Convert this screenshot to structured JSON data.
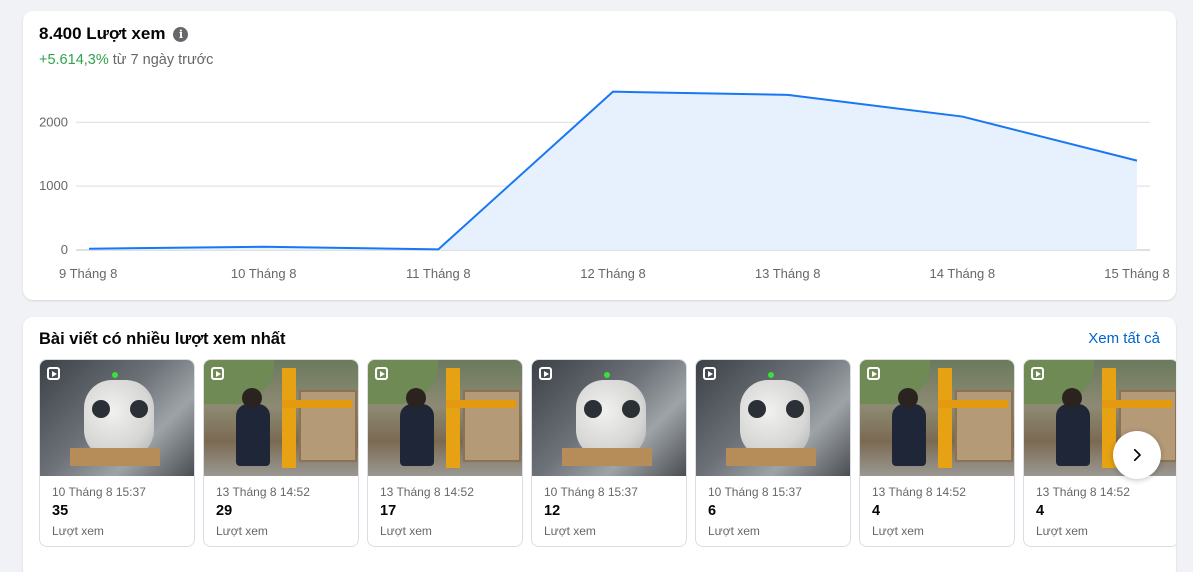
{
  "views_card": {
    "title": "8.400 Lượt xem",
    "change_pct": "+5.614,3%",
    "change_text": " từ 7 ngày trước",
    "info_icon": "info-icon"
  },
  "chart_data": {
    "type": "area",
    "x": [
      "9 Tháng 8",
      "10 Tháng 8",
      "11 Tháng 8",
      "12 Tháng 8",
      "13 Tháng 8",
      "14 Tháng 8",
      "15 Tháng 8"
    ],
    "y": [
      20,
      50,
      10,
      2480,
      2430,
      2090,
      1400
    ],
    "yticks": [
      0,
      1000,
      2000
    ],
    "ylim": [
      0,
      2600
    ],
    "grid": true,
    "line_color": "#1877f2",
    "fill_color": "#e7f0fd"
  },
  "posts_card": {
    "title": "Bài viết có nhiều lượt xem nhất",
    "see_all": "Xem tất cả",
    "next_icon": "chevron-right-icon",
    "posts": [
      {
        "date": "10 Tháng 8 15:37",
        "count": "35",
        "label": "Lượt xem",
        "thumb": "pump"
      },
      {
        "date": "13 Tháng 8 14:52",
        "count": "29",
        "label": "Lượt xem",
        "thumb": "worker"
      },
      {
        "date": "13 Tháng 8 14:52",
        "count": "17",
        "label": "Lượt xem",
        "thumb": "worker"
      },
      {
        "date": "10 Tháng 8 15:37",
        "count": "12",
        "label": "Lượt xem",
        "thumb": "pump"
      },
      {
        "date": "10 Tháng 8 15:37",
        "count": "6",
        "label": "Lượt xem",
        "thumb": "pump"
      },
      {
        "date": "13 Tháng 8 14:52",
        "count": "4",
        "label": "Lượt xem",
        "thumb": "worker"
      },
      {
        "date": "13 Tháng 8 14:52",
        "count": "4",
        "label": "Lượt xem",
        "thumb": "worker"
      }
    ]
  },
  "colors": {
    "accent": "#1877f2",
    "link": "#0064d1",
    "positive": "#31a24c",
    "secondary_text": "#65676b"
  }
}
